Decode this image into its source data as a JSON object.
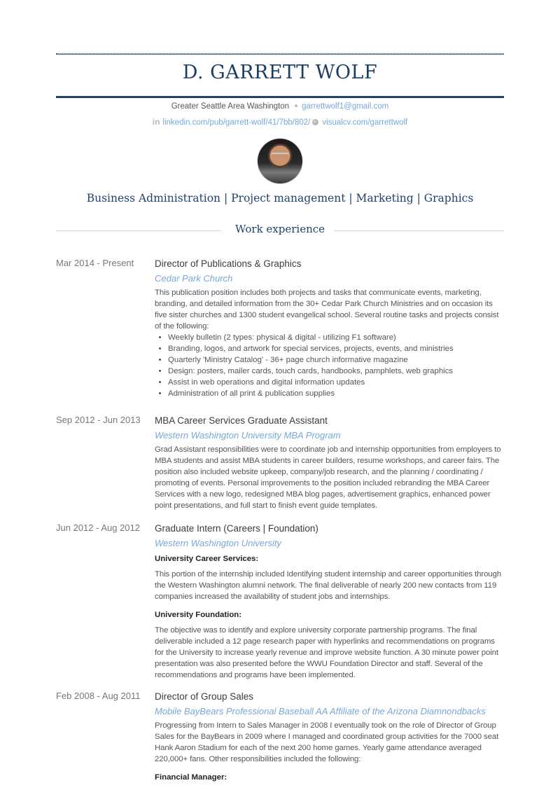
{
  "header": {
    "name": "D. GARRETT WOLF",
    "location": "Greater Seattle Area Washington",
    "email": "garrettwolf1@gmail.com",
    "linkedin": "linkedin.com/pub/garrett-wolf/41/7bb/802/",
    "website": "visualcv.com/garrettwolf",
    "headline": "Business Administration | Project management | Marketing | Graphics",
    "colors": {
      "accent": "#1f426c",
      "link": "#78a7d8"
    }
  },
  "sections": {
    "work_title": "Work experience"
  },
  "jobs": [
    {
      "dates": "Mar 2014 - Present",
      "title": "Director of Publications & Graphics",
      "company": "Cedar Park Church",
      "description": "This publication position includes both projects and tasks that communicate events, marketing, branding, and detailed information from the 30+ Cedar Park Church Ministries and on occasion its five sister churches and 1300 student evangelical school. Several routine tasks and projects consist of the following:",
      "bullets": [
        "Weekly bulletin (2 types: physical & digital - utilizing F1 software)",
        "Branding, logos, and artwork for special services, projects, events, and ministries",
        "Quarterly 'Ministry Catalog' - 36+ page church informative magazine",
        "Design: posters, mailer cards, touch cards, handbooks, pamphlets, web graphics",
        "Assist in web operations and digital information updates",
        "Administration of all print & publication supplies"
      ]
    },
    {
      "dates": "Sep 2012 - Jun 2013",
      "title": "MBA Career Services Graduate Assistant",
      "company": "Western Washington University MBA Program",
      "description": "Grad Assistant responsibilities were to coordinate job and internship opportunities from employers to MBA students and assist MBA students in career builders, resume workshops, and career fairs. The position also included website upkeep, company/job research, and the planning / coordinating / promoting of events. Personal improvements to the position included rebranding the MBA Career Services with a new logo, redesigned MBA blog pages, advertisement graphics, enhanced power point presentations, and full start to finish event guide templates."
    },
    {
      "dates": "Jun 2012 - Aug 2012",
      "title": "Graduate Intern (Careers | Foundation)",
      "company": "Western Washington University",
      "subsections": [
        {
          "heading": "University Career Services:",
          "text": "This portion of the internship included Identifying student internship and career opportunities through the Western Washington alumni network. The final deliverable of nearly 200 new contacts from 119 companies increased the availability of student jobs and internships."
        },
        {
          "heading": "University Foundation:",
          "text": "The objective was to identify and explore university corporate partnership programs. The final deliverable included a 12 page research paper with hyperlinks and recommendations on programs for the University to increase yearly revenue and improve website function. A 30 minute power point presentation was also presented before the WWU Foundation Director and staff. Several of the recommendations and programs have been implemented."
        }
      ]
    },
    {
      "dates": "Feb 2008 - Aug 2011",
      "title": "Director of Group Sales",
      "company": "Mobile BayBears Professional Baseball AA Affiliate of the Arizona Diamnondbacks",
      "description": "Progressing from Intern to Sales Manager in 2008 I eventually took on the role of Director of Group Sales for the BayBears in 2009 where I managed and coordinated group activities for the 7000 seat Hank Aaron Stadium for each of the next 200 home games. Yearly game attendance averaged 220,000+ fans. Other responsibilities included the following:",
      "subheading": "Financial Manager:"
    }
  ]
}
